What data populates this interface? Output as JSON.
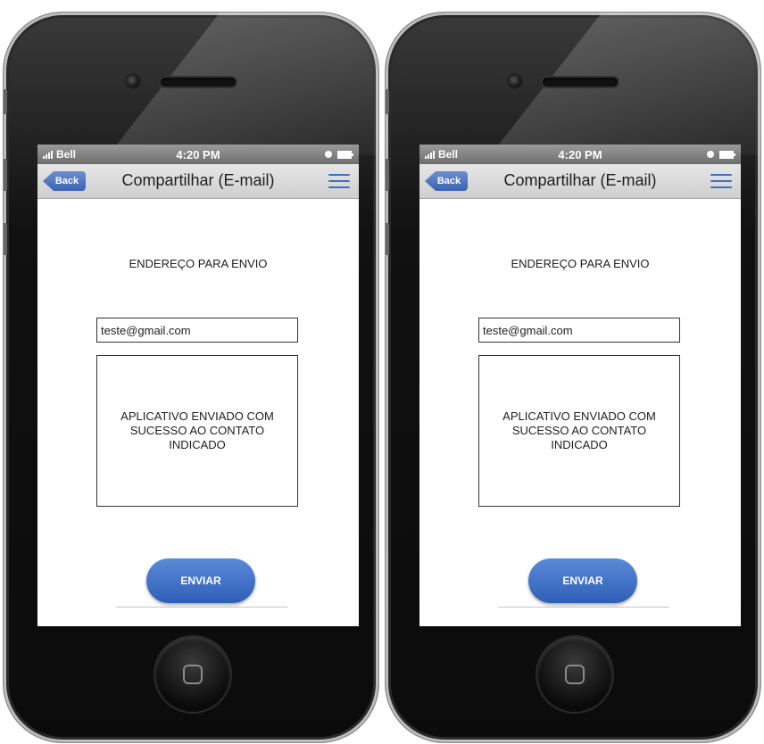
{
  "phones": [
    {
      "status": {
        "carrier": "Bell",
        "time": "4:20 PM"
      },
      "nav": {
        "back_label": "Back",
        "title": "Compartilhar (E-mail)"
      },
      "content": {
        "heading": "ENDEREÇO PARA ENVIO",
        "email_value": "teste@gmail.com",
        "message": "APLICATIVO ENVIADO COM SUCESSO AO CONTATO INDICADO",
        "send_label": "ENVIAR"
      }
    },
    {
      "status": {
        "carrier": "Bell",
        "time": "4:20 PM"
      },
      "nav": {
        "back_label": "Back",
        "title": "Compartilhar (E-mail)"
      },
      "content": {
        "heading": "ENDEREÇO PARA ENVIO",
        "email_value": "teste@gmail.com",
        "message": "APLICATIVO ENVIADO COM SUCESSO AO CONTATO INDICADO",
        "send_label": "ENVIAR"
      }
    }
  ],
  "icons": {
    "signal": "signal-bars-icon",
    "battery": "battery-icon",
    "status_dot": "status-dot-icon",
    "menu": "hamburger-menu-icon",
    "home": "home-button-icon",
    "camera": "camera-icon",
    "speaker": "speaker-icon"
  },
  "colors": {
    "accent": "#3b6fc4",
    "button": "#2f5fb6",
    "statusbar": "#7a7a7a",
    "navbar": "#dcdcdc"
  }
}
